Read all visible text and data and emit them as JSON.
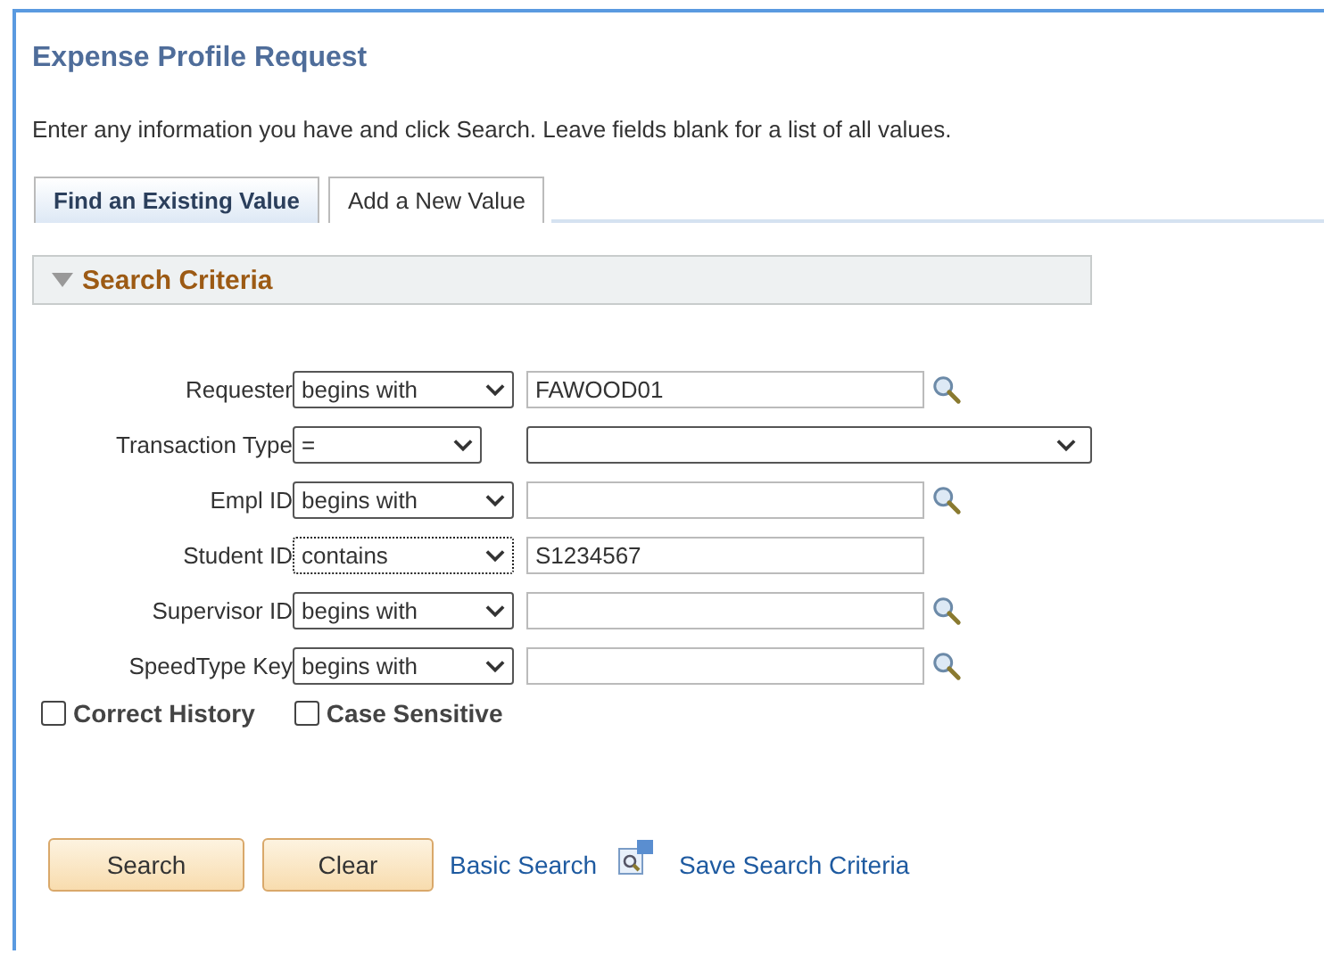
{
  "page": {
    "title": "Expense Profile Request",
    "instructions": "Enter any information you have and click Search. Leave fields blank for a list of all values."
  },
  "tabs": [
    {
      "label": "Find an Existing Value",
      "selected": true
    },
    {
      "label": "Add a New Value",
      "selected": false
    }
  ],
  "section": {
    "title": "Search Criteria",
    "expanded": true
  },
  "criteria": [
    {
      "label": "Requester",
      "operator": "begins with",
      "kind": "lookup",
      "value": "FAWOOD01",
      "focused": false
    },
    {
      "label": "Transaction Type",
      "operator": "=",
      "kind": "select",
      "focused": false
    },
    {
      "label": "Empl ID",
      "operator": "begins with",
      "kind": "lookup",
      "focused": false
    },
    {
      "label": "Student ID",
      "operator": "contains",
      "kind": "text",
      "value": "S1234567",
      "focused": true
    },
    {
      "label": "Supervisor ID",
      "operator": "begins with",
      "kind": "lookup",
      "focused": false
    },
    {
      "label": "SpeedType Key",
      "operator": "begins with",
      "kind": "lookup",
      "focused": false
    }
  ],
  "options": [
    {
      "label": "Correct History",
      "checked": false
    },
    {
      "label": "Case Sensitive",
      "checked": false
    }
  ],
  "buttons": [
    "Search",
    "Clear"
  ],
  "links": [
    {
      "label": "Basic Search",
      "kind": "link"
    },
    {
      "label": "Save Search Criteria",
      "kind": "icon-link"
    }
  ]
}
